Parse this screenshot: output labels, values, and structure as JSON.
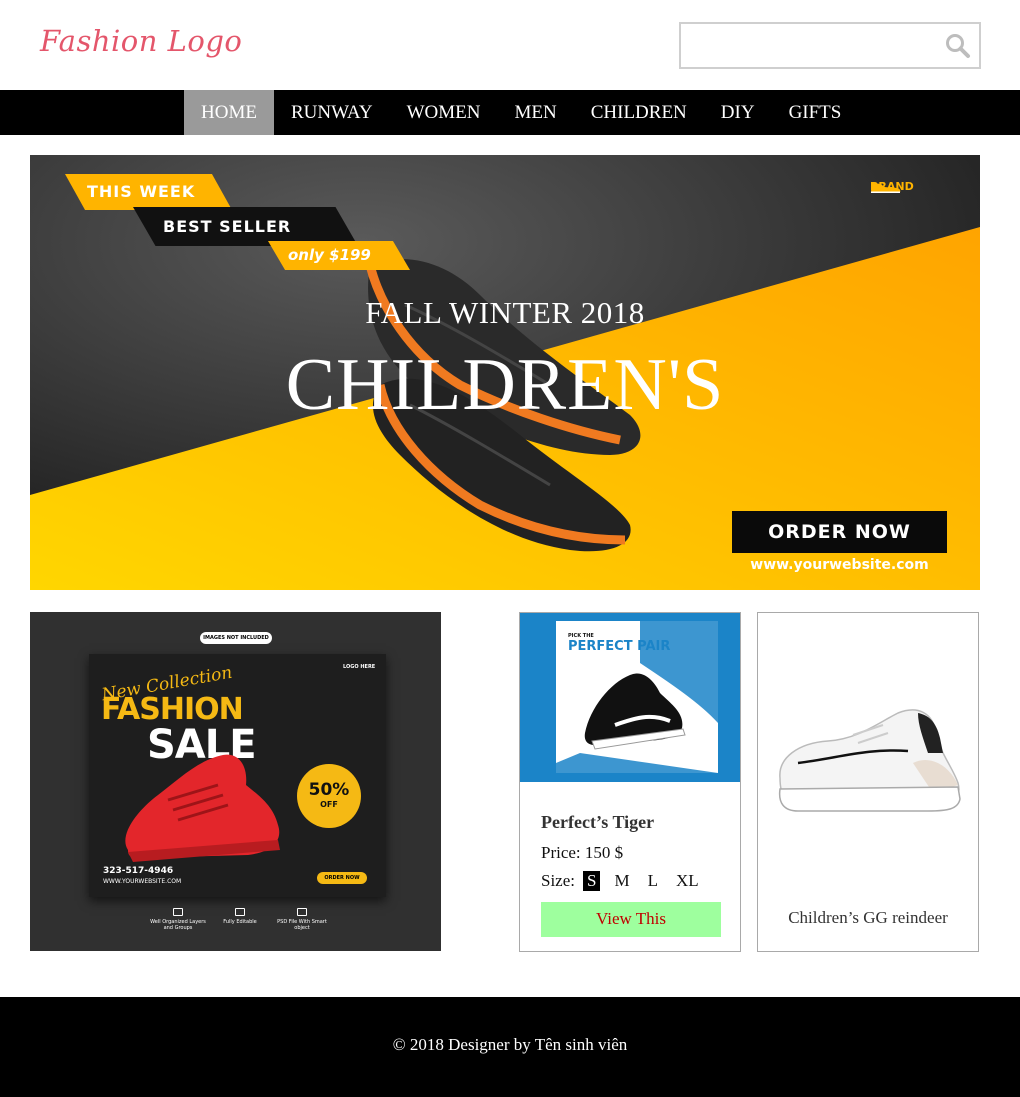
{
  "header": {
    "logo_text": "Fashion Logo",
    "search_placeholder": "",
    "search_icon": "search-icon"
  },
  "nav": {
    "items": [
      {
        "label": "HOME",
        "active": true
      },
      {
        "label": "RUNWAY",
        "active": false
      },
      {
        "label": "WOMEN",
        "active": false
      },
      {
        "label": "MEN",
        "active": false
      },
      {
        "label": "CHILDREN",
        "active": false
      },
      {
        "label": "DIY",
        "active": false
      },
      {
        "label": "GIFTS",
        "active": false
      }
    ]
  },
  "banner": {
    "tag_week": "THIS WEEK",
    "tag_best": "BEST SELLER",
    "tag_price": "only $199",
    "brand": "BRAND",
    "season": "FALL WINTER 2018",
    "headline": "CHILDREN'S",
    "order_label": "ORDER NOW",
    "website": "www.yourwebsite.com"
  },
  "promo": {
    "badge_top": "IMAGES NOT INCLUDED",
    "new_collection": "New Collection",
    "fashion": "FASHION",
    "sale": "SALE",
    "logo_here": "LOGO HERE",
    "discount_pct": "50%",
    "discount_off": "OFF",
    "phone": "323-517-4946",
    "url": "WWW.YOURWEBSITE.COM",
    "order": "ORDER NOW",
    "features": [
      "Well Organized Layers and Groups",
      "Fully Editable",
      "PSD File With Smart object"
    ]
  },
  "products": [
    {
      "title": "Perfect’s Tiger",
      "price_label": "Price: 150 $",
      "size_label": "Size:",
      "sizes": [
        "S",
        "M",
        "L",
        "XL"
      ],
      "selected_size": "S",
      "button_label": "View This",
      "image_text_small": "PICK THE",
      "image_text_big": "PERFECT PAIR"
    },
    {
      "title": "Children’s GG reindeer"
    }
  ],
  "footer": {
    "copyright": "© 2018 Designer by Tên sinh viên"
  },
  "colors": {
    "logo": "#e4566b",
    "nav_bg": "#000000",
    "nav_active": "#9a9a9a",
    "accent_yellow": "#ffb400",
    "view_button_bg": "#9eff9e",
    "view_button_text": "#c00000"
  }
}
